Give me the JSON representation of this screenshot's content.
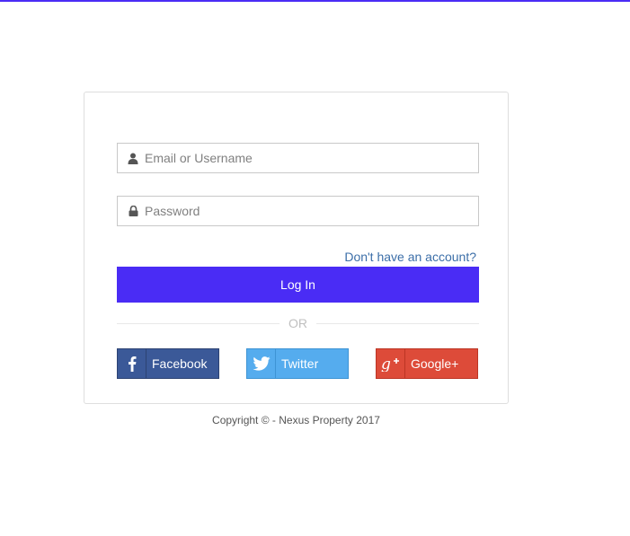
{
  "login": {
    "username_placeholder": "Email or Username",
    "password_placeholder": "Password",
    "signup_link": "Don't have an account?",
    "login_button": "Log In",
    "divider_text": "OR"
  },
  "social": {
    "facebook": "Facebook",
    "twitter": "Twitter",
    "google": "Google+"
  },
  "footer": {
    "copyright": "Copyright © - Nexus Property 2017"
  },
  "colors": {
    "accent": "#4a2cf5",
    "facebook": "#3b5998",
    "twitter": "#55acee",
    "google": "#dd4b39",
    "link": "#3b6ea8"
  },
  "icons": {
    "username": "user-icon",
    "password": "lock-icon",
    "facebook": "facebook-icon",
    "twitter": "twitter-icon",
    "google": "google-plus-icon"
  }
}
